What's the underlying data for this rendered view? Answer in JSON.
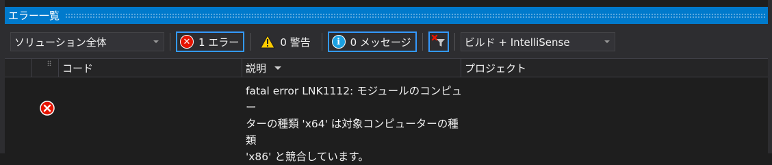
{
  "window": {
    "title": "エラー一覧"
  },
  "toolbar": {
    "scope": {
      "value": "ソリューション全体"
    },
    "errors": {
      "label": "1 エラー"
    },
    "warnings": {
      "label": "0 警告"
    },
    "messages": {
      "label": "0 メッセージ"
    },
    "build_filter": {
      "value": "ビルド + IntelliSense"
    }
  },
  "columns": {
    "code": "コード",
    "description": "説明",
    "project": "プロジェクト"
  },
  "rows": [
    {
      "severity": "error",
      "code": "",
      "description": "fatal error LNK1112: モジュールのコンピュー\nターの種類 'x64' は対象コンピューターの種類\n'x86' と競合しています。",
      "project": ""
    }
  ],
  "colors": {
    "accent": "#007acc",
    "error": "#e51400",
    "warning": "#ffcc00",
    "info": "#1ba1e2",
    "selection_border": "#3399ff"
  }
}
